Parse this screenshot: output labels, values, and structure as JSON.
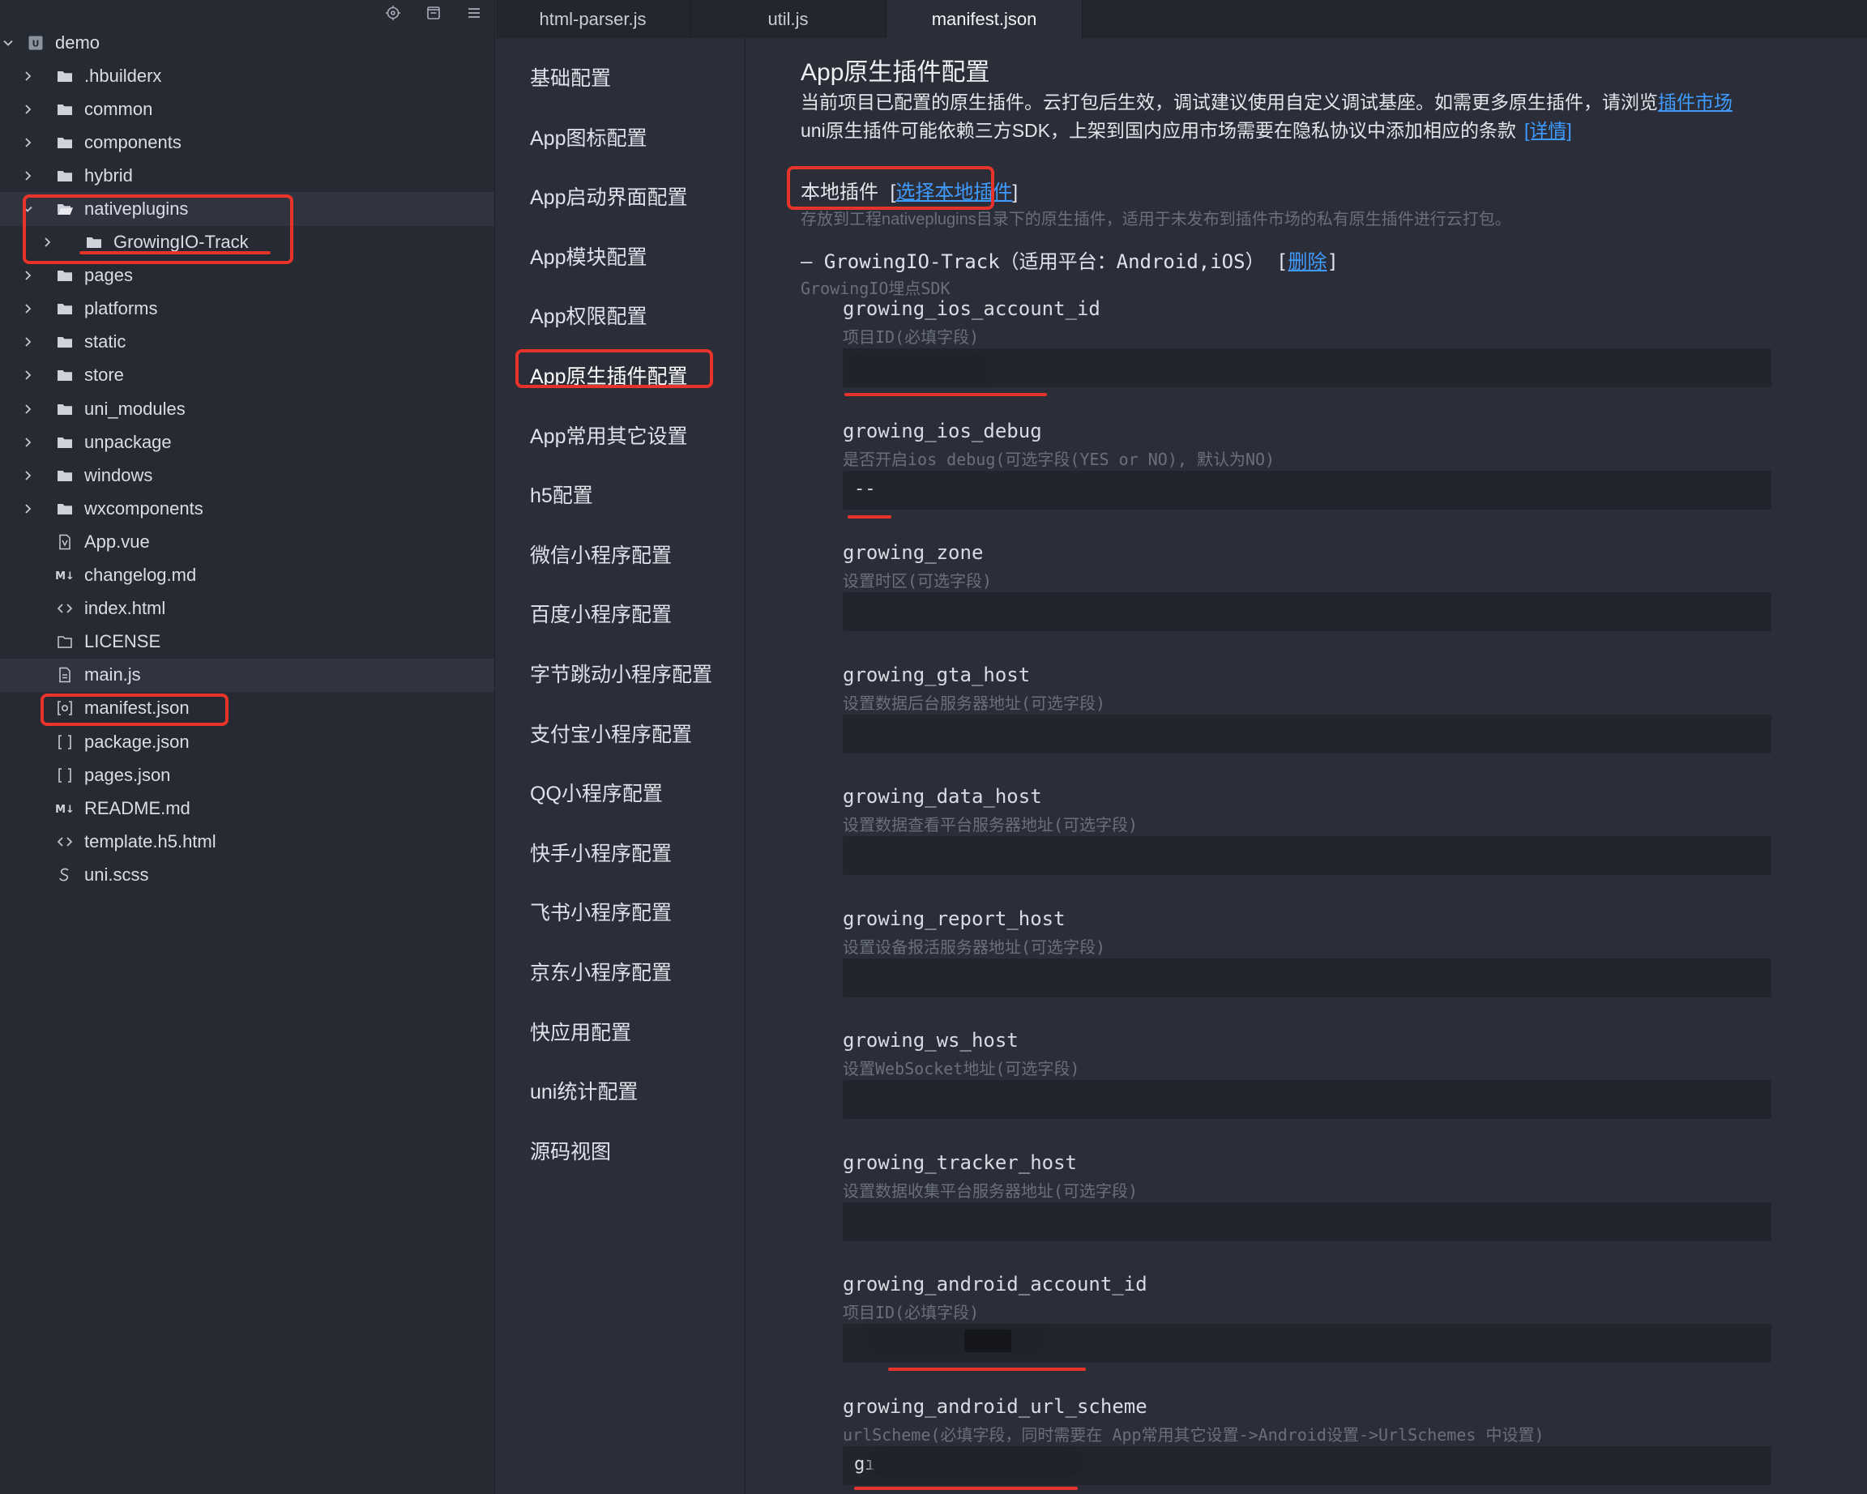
{
  "sidebar": {
    "toolbar": [
      {
        "icon": "locate-icon"
      },
      {
        "icon": "collapse-all-icon"
      },
      {
        "icon": "menu-icon"
      }
    ],
    "tree": [
      {
        "label": "demo",
        "kind": "project",
        "level": 0,
        "expanded": true
      },
      {
        "label": ".hbuilderx",
        "kind": "folder",
        "level": 1
      },
      {
        "label": "common",
        "kind": "folder",
        "level": 1
      },
      {
        "label": "components",
        "kind": "folder",
        "level": 1
      },
      {
        "label": "hybrid",
        "kind": "folder",
        "level": 1
      },
      {
        "label": "nativeplugins",
        "kind": "folder",
        "level": 1,
        "expanded": true,
        "selected": true
      },
      {
        "label": "GrowingIO-Track",
        "kind": "folder",
        "level": 2
      },
      {
        "label": "pages",
        "kind": "folder",
        "level": 1
      },
      {
        "label": "platforms",
        "kind": "folder",
        "level": 1
      },
      {
        "label": "static",
        "kind": "folder",
        "level": 1
      },
      {
        "label": "store",
        "kind": "folder",
        "level": 1
      },
      {
        "label": "uni_modules",
        "kind": "folder",
        "level": 1
      },
      {
        "label": "unpackage",
        "kind": "folder",
        "level": 1
      },
      {
        "label": "windows",
        "kind": "folder",
        "level": 1
      },
      {
        "label": "wxcomponents",
        "kind": "folder",
        "level": 1
      },
      {
        "label": "App.vue",
        "kind": "vue",
        "level": 1
      },
      {
        "label": "changelog.md",
        "kind": "md",
        "level": 1
      },
      {
        "label": "index.html",
        "kind": "html",
        "level": 1
      },
      {
        "label": "LICENSE",
        "kind": "file",
        "level": 1
      },
      {
        "label": "main.js",
        "kind": "js",
        "level": 1,
        "selected": true
      },
      {
        "label": "manifest.json",
        "kind": "manifest",
        "level": 1
      },
      {
        "label": "package.json",
        "kind": "json",
        "level": 1
      },
      {
        "label": "pages.json",
        "kind": "json",
        "level": 1
      },
      {
        "label": "README.md",
        "kind": "md",
        "level": 1
      },
      {
        "label": "template.h5.html",
        "kind": "html",
        "level": 1
      },
      {
        "label": "uni.scss",
        "kind": "scss",
        "level": 1
      }
    ]
  },
  "tabs": [
    {
      "label": "html-parser.js",
      "active": false
    },
    {
      "label": "util.js",
      "active": false
    },
    {
      "label": "manifest.json",
      "active": true
    }
  ],
  "settings_nav": [
    "基础配置",
    "App图标配置",
    "App启动界面配置",
    "App模块配置",
    "App权限配置",
    "App原生插件配置",
    "App常用其它设置",
    "h5配置",
    "微信小程序配置",
    "百度小程序配置",
    "字节跳动小程序配置",
    "支付宝小程序配置",
    "QQ小程序配置",
    "快手小程序配置",
    "飞书小程序配置",
    "京东小程序配置",
    "快应用配置",
    "uni统计配置",
    "源码视图"
  ],
  "active_nav": "App原生插件配置",
  "main": {
    "title": "App原生插件配置",
    "desc1_text": "当前项目已配置的原生插件。云打包后生效，调试建议使用自定义调试基座。如需更多原生插件，请浏览",
    "desc1_link": "插件市场",
    "desc2_text": "uni原生插件可能依赖三方SDK，上架到国内应用市场需要在隐私协议中添加相应的条款",
    "desc2_link": "[详情]",
    "local_label": "本地插件",
    "local_bracket_open": "[",
    "local_link": "选择本地插件",
    "local_bracket_close": "]",
    "local_hint": "存放到工程nativeplugins目录下的原生插件，适用于未发布到插件市场的私有原生插件进行云打包。",
    "plugin_line": "– GrowingIO-Track（适用平台：Android,iOS）",
    "plugin_delete_open": "[",
    "plugin_delete": "删除",
    "plugin_delete_close": "]",
    "plugin_desc": "GrowingIO埋点SDK",
    "fields": [
      {
        "name": "growing_ios_account_id",
        "hint": "项目ID(必填字段)",
        "value": ""
      },
      {
        "name": "growing_ios_debug",
        "hint": "是否开启ios debug(可选字段(YES or NO), 默认为NO)",
        "value": "--"
      },
      {
        "name": "growing_zone",
        "hint": "设置时区(可选字段)",
        "value": ""
      },
      {
        "name": "growing_gta_host",
        "hint": "设置数据后台服务器地址(可选字段)",
        "value": ""
      },
      {
        "name": "growing_data_host",
        "hint": "设置数据查看平台服务器地址(可选字段)",
        "value": ""
      },
      {
        "name": "growing_report_host",
        "hint": "设置设备报活服务器地址(可选字段)",
        "value": ""
      },
      {
        "name": "growing_ws_host",
        "hint": "设置WebSocket地址(可选字段)",
        "value": ""
      },
      {
        "name": "growing_tracker_host",
        "hint": "设置数据收集平台服务器地址(可选字段)",
        "value": ""
      },
      {
        "name": "growing_android_account_id",
        "hint": "项目ID(必填字段)",
        "value": ""
      },
      {
        "name": "growing_android_url_scheme",
        "hint": "urlScheme(必填字段，同时需要在 App常用其它设置->Android设置->UrlSchemes 中设置)",
        "value": "gı"
      }
    ]
  }
}
